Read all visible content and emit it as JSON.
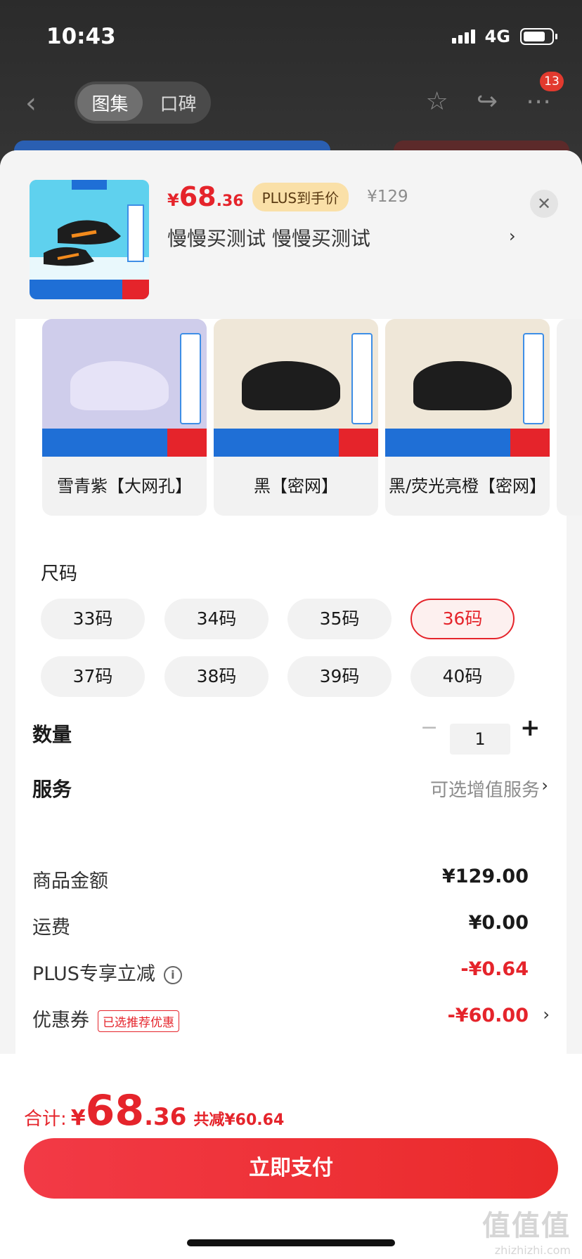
{
  "status_bar": {
    "time": "10:43",
    "network": "4G",
    "battery_level": 0.8
  },
  "nav": {
    "tabs": [
      {
        "label": "图集",
        "active": true
      },
      {
        "label": "口碑",
        "active": false
      }
    ],
    "badge": "13"
  },
  "product": {
    "price_symbol": "¥",
    "price_int": "68",
    "price_dec": ".36",
    "plus_tag": "PLUS到手价",
    "original_price": "¥129",
    "title": "慢慢买测试  慢慢买测试"
  },
  "variants": [
    {
      "label": "雪青紫【大网孔】",
      "image_tone": "#cfcdeb",
      "shoe_color": "#e6e3f7"
    },
    {
      "label": "黑【密网】",
      "image_tone": "#efe7d8",
      "shoe_color": "#1d1d1d"
    },
    {
      "label": "黑/荧光亮橙【密网】",
      "image_tone": "#efe7d8",
      "shoe_color": "#1d1d1d"
    }
  ],
  "size": {
    "title": "尺码",
    "options": [
      "33码",
      "34码",
      "35码",
      "36码",
      "37码",
      "38码",
      "39码",
      "40码"
    ],
    "selected": "36码"
  },
  "quantity": {
    "label": "数量",
    "value": "1",
    "minus": "−",
    "plus": "+"
  },
  "service": {
    "label": "服务",
    "value": "可选增值服务"
  },
  "costs": {
    "goods_label": "商品金额",
    "goods_value": "¥129.00",
    "shipping_label": "运费",
    "shipping_value": "¥0.00",
    "plus_label": "PLUS专享立减",
    "plus_value": "-¥0.64",
    "coupon_label": "优惠券",
    "coupon_tag": "已选推荐优惠",
    "coupon_value": "-¥60.00"
  },
  "total": {
    "label": "合计:",
    "symbol": "¥",
    "int": "68",
    "dec": ".36",
    "saved": "共减¥60.64"
  },
  "pay_button": "立即支付",
  "watermark": {
    "big": "值值值",
    "small": "zhizhizhi.com"
  },
  "colors": {
    "accent": "#e5242b",
    "plus_tag_bg": "#fae0a8"
  }
}
